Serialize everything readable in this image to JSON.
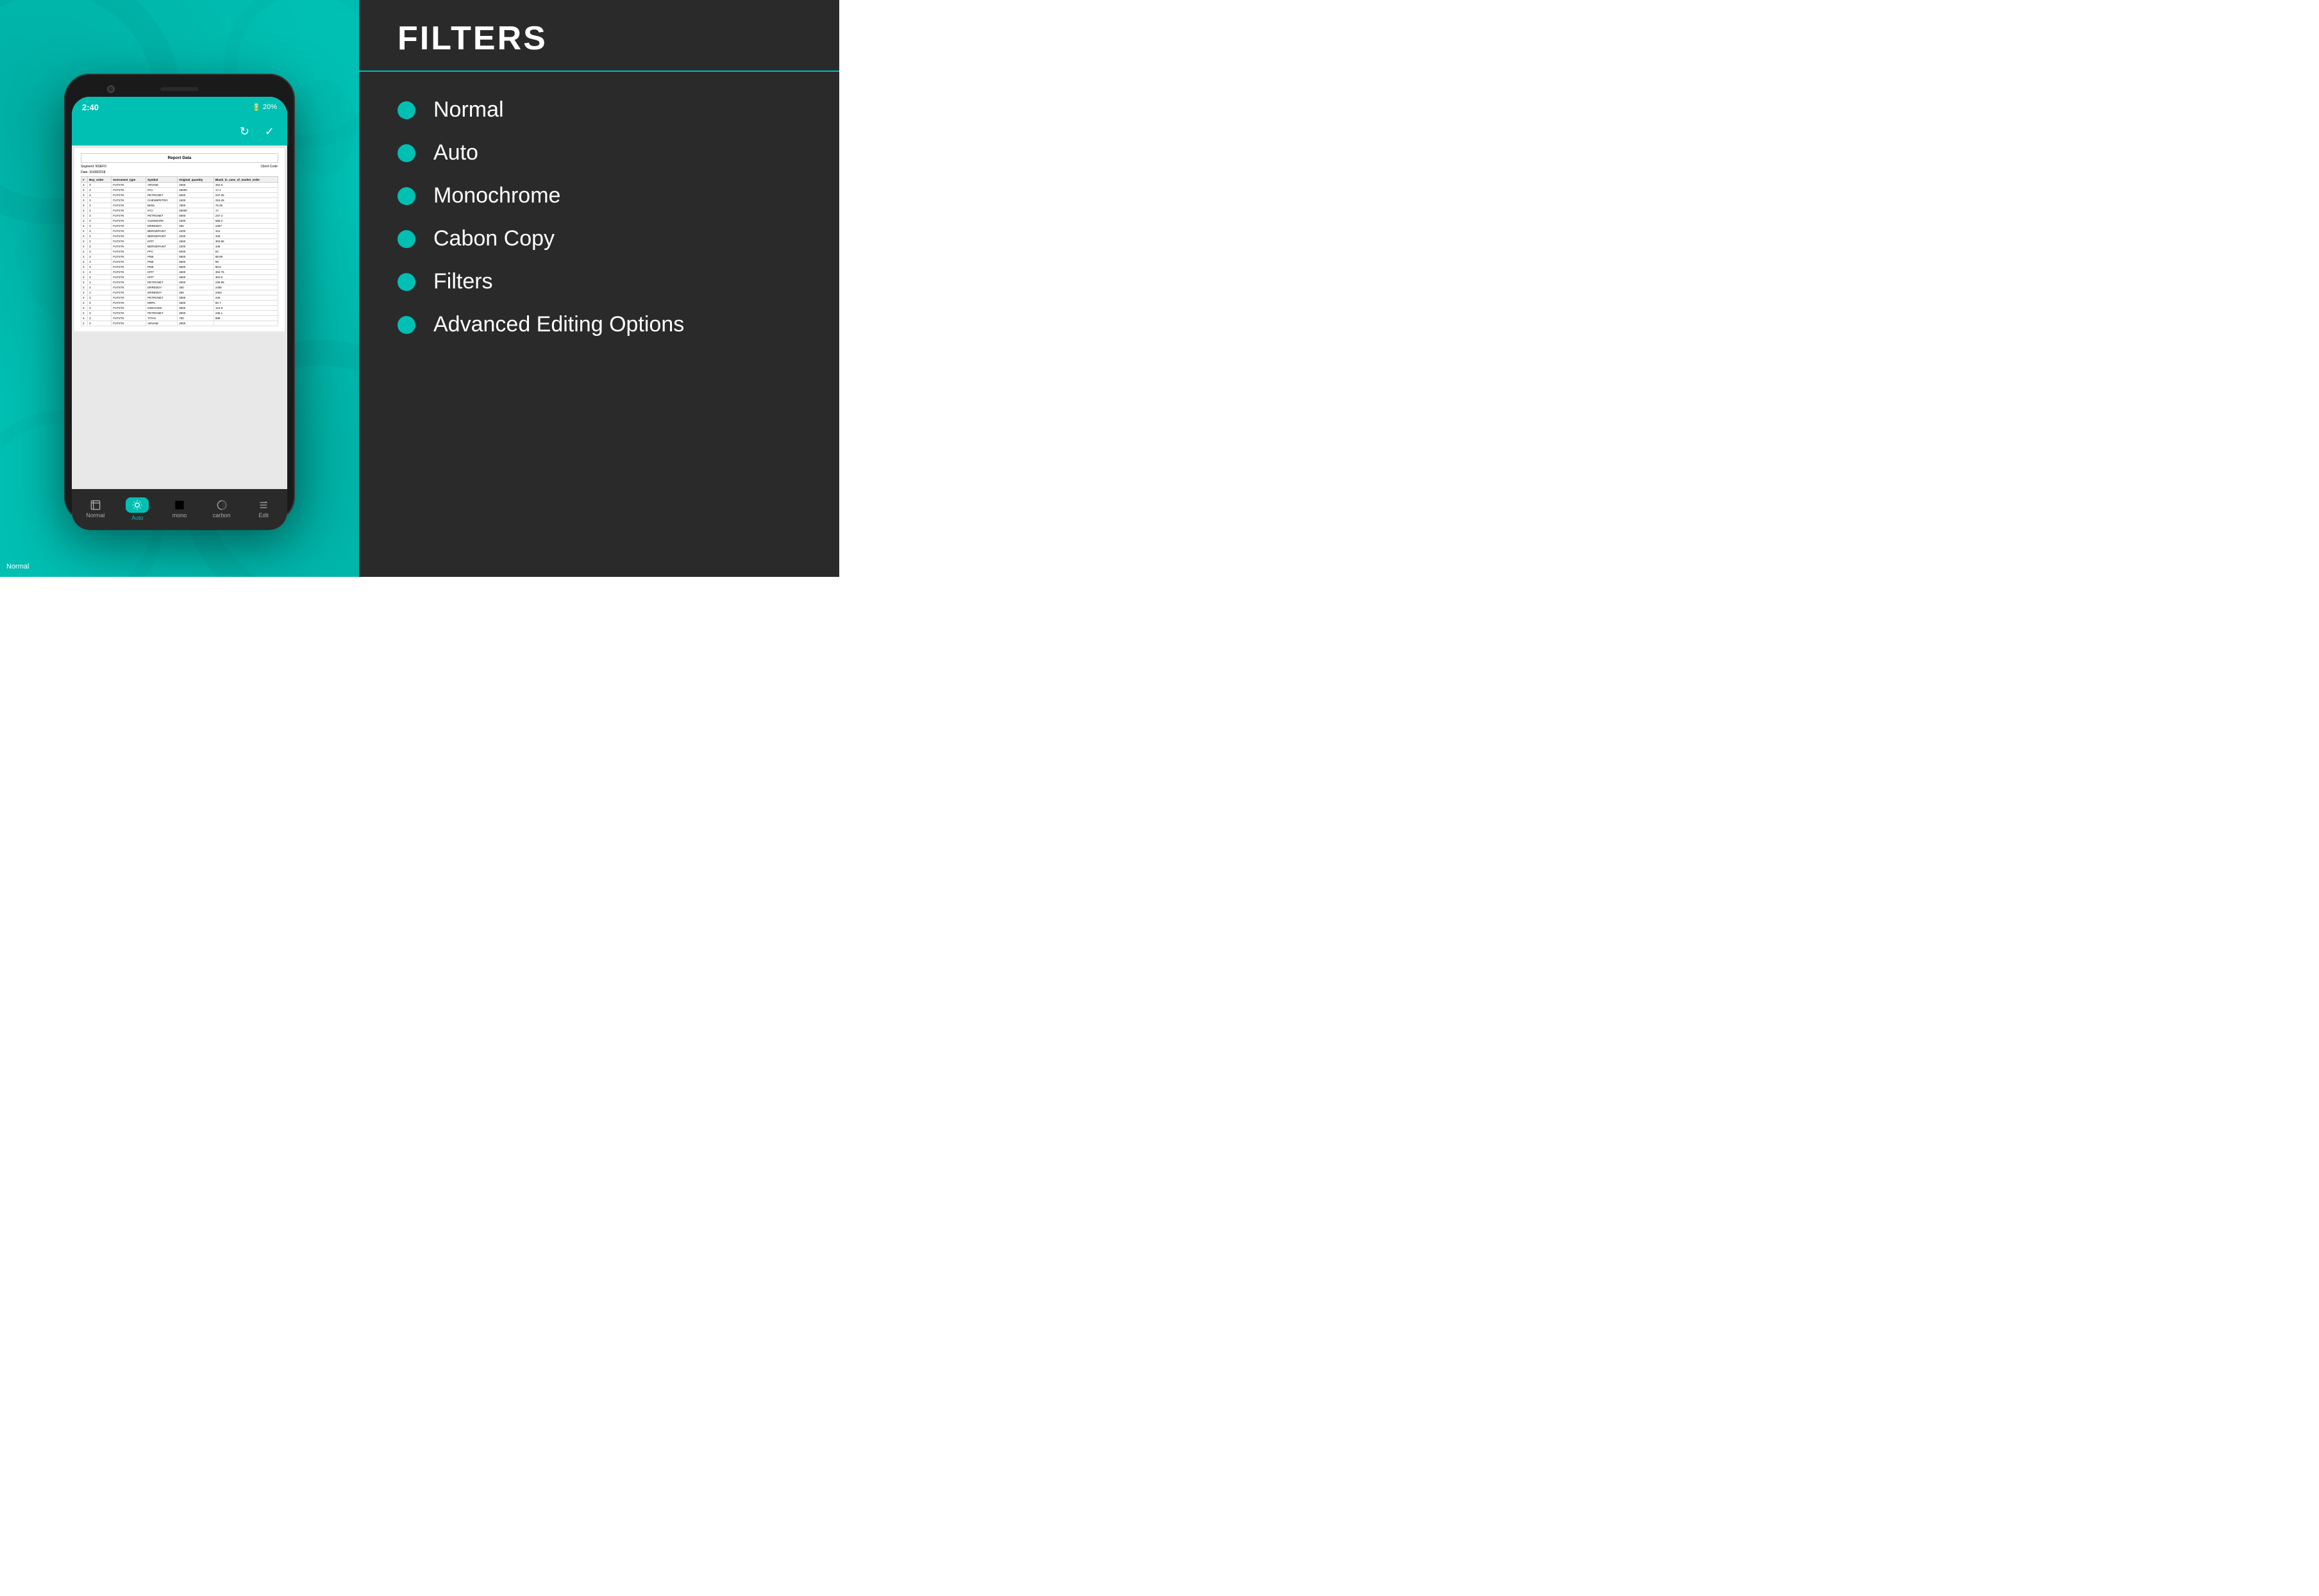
{
  "page": {
    "title": "FILTERS"
  },
  "left_panel": {
    "background_color": "#00bfb3"
  },
  "phone": {
    "status_bar": {
      "time": "2:40",
      "battery": "20%"
    },
    "toolbar": {
      "refresh_icon": "↻",
      "check_icon": "✓"
    },
    "document": {
      "header": "Report Data",
      "segment": "Segment: NSEFO",
      "client_code": "Client Code:",
      "date": "Date: 31/08/2018",
      "columns": [
        "#",
        "Buy_order",
        "Instrument_type",
        "Symbol",
        "Original_quantity",
        "Blank_in_case_of_market_order"
      ],
      "rows": [
        [
          "3",
          "FUTSTK",
          "ARVIND",
          "2000",
          "402.9"
        ],
        [
          "3",
          "FUTSTK",
          "IFCI",
          "25000",
          "17.1"
        ],
        [
          "3",
          "FUTSTK",
          "PETRONET",
          "6000",
          "237.05"
        ],
        [
          "3",
          "FUTSTK",
          "CHENNPETRO",
          "1500",
          "318.45"
        ],
        [
          "3",
          "FUTSTK",
          "BHEL",
          "7500",
          "79.35"
        ],
        [
          "3",
          "FUTSTK",
          "IFCI",
          "25000",
          "17"
        ],
        [
          "3",
          "FUTSTK",
          "PETRONET",
          "6000",
          "237.4"
        ],
        [
          "3",
          "FUTSTK",
          "GLENMARK",
          "1000",
          "568.2"
        ],
        [
          "3",
          "FUTSTK",
          "DRREDDY",
          "250",
          "2457"
        ],
        [
          "3",
          "FUTSTK",
          "BERGEPAINT",
          "2200",
          "341"
        ],
        [
          "3",
          "FUTSTK",
          "BERGEPAINT",
          "2200",
          "345"
        ],
        [
          "3",
          "FUTSTK",
          "KPIT",
          "4500",
          "303.65"
        ],
        [
          "3",
          "FUTSTK",
          "BERGEPAINT",
          "2200",
          "345"
        ],
        [
          "3",
          "FUTSTK",
          "PFC",
          "6000",
          "92"
        ],
        [
          "3",
          "FUTSTK",
          "PNB",
          "5500",
          "88.95"
        ],
        [
          "3",
          "FUTSTK",
          "PNB",
          "5500",
          "89"
        ],
        [
          "3",
          "FUTSTK",
          "PNB",
          "5500",
          "88.8"
        ],
        [
          "3",
          "FUTSTK",
          "KPIT",
          "4500",
          "302.75"
        ],
        [
          "3",
          "FUTSTK",
          "KPIT",
          "4500",
          "302.9"
        ],
        [
          "3",
          "FUTSTK",
          "PETRONET",
          "3000",
          "239.95"
        ],
        [
          "3",
          "FUTSTK",
          "DRREDDY",
          "250",
          "2455"
        ],
        [
          "3",
          "FUTSTK",
          "DRREDDY",
          "250",
          "2452"
        ],
        [
          "3",
          "FUTSTK",
          "PETRONET",
          "3000",
          "245"
        ],
        [
          "3",
          "FUTSTK",
          "MRPL",
          "4500",
          "80.7"
        ],
        [
          "3",
          "FUTSTK",
          "INDIACEM",
          "3500",
          "124.9"
        ],
        [
          "3",
          "FUTSTK",
          "PETRONET",
          "3000",
          "235.1"
        ],
        [
          "3",
          "FUTSTK",
          "TITAN",
          "750",
          "899"
        ],
        [
          "3",
          "FUTSTK",
          "ARVIND",
          "3000",
          ""
        ]
      ]
    },
    "bottom_nav": [
      {
        "id": "normal",
        "label": "Normal",
        "icon": "🖼",
        "active": false
      },
      {
        "id": "auto",
        "label": "Auto",
        "icon": "☀",
        "active": true
      },
      {
        "id": "mono",
        "label": "mono",
        "icon": "◼",
        "active": false
      },
      {
        "id": "carbon",
        "label": "carbon",
        "icon": "◑",
        "active": false
      },
      {
        "id": "edit",
        "label": "Edit",
        "icon": "☰",
        "active": false
      }
    ]
  },
  "right_panel": {
    "title": "FILTERS",
    "divider_color": "#00bfb3",
    "filters": [
      {
        "label": "Normal"
      },
      {
        "label": "Auto"
      },
      {
        "label": "Monochrome"
      },
      {
        "label": "Cabon Copy"
      },
      {
        "label": "Filters"
      },
      {
        "label": "Advanced Editing Options"
      }
    ],
    "dot_color": "#00bfb3"
  },
  "bottom_label": "Normal"
}
